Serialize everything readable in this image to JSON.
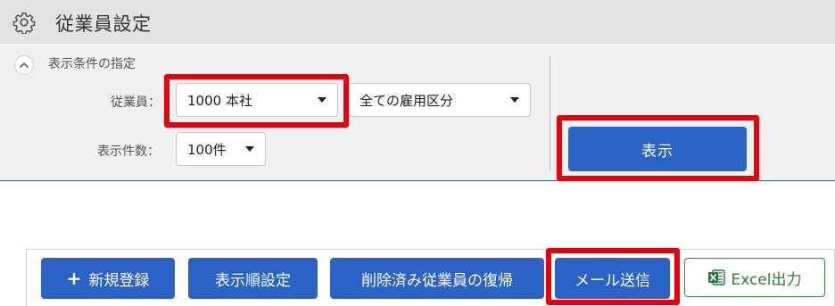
{
  "header": {
    "title": "従業員設定",
    "icon": "gear-icon"
  },
  "filter": {
    "section_title": "表示条件の指定",
    "employee_label": "従業員：",
    "employee_value": "1000 本社",
    "employment_type_value": "全ての雇用区分",
    "count_label": "表示件数：",
    "count_value": "100件",
    "show_button": "表示"
  },
  "toolbar": {
    "new_button": "新規登録",
    "order_button": "表示順設定",
    "restore_button": "削除済み従業員の復帰",
    "mail_button": "メール送信",
    "excel_button": "Excel出力"
  },
  "colors": {
    "primary": "#2a62c5",
    "highlight": "#e8000b",
    "excel": "#2e7d35"
  }
}
